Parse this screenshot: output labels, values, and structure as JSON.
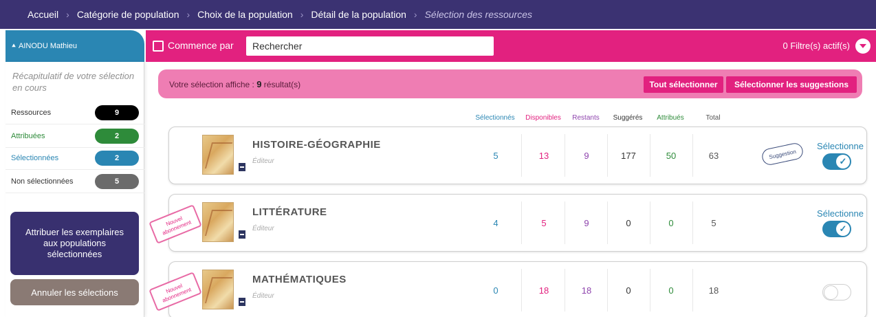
{
  "breadcrumb": {
    "items": [
      "Accueil",
      "Catégorie de population",
      "Choix de la population",
      "Détail de la population"
    ],
    "current": "Sélection des ressources"
  },
  "user": {
    "name": "AINODU Mathieu"
  },
  "sidebar": {
    "recap": "Récapitulatif de votre sélection en cours",
    "stats": [
      {
        "label": "Ressources",
        "value": "9",
        "color": "#000000",
        "label_color": "#333333"
      },
      {
        "label": "Attribuées",
        "value": "2",
        "color": "#2e8b3a",
        "label_color": "#2e8b3a"
      },
      {
        "label": "Sélectionnées",
        "value": "2",
        "color": "#2a86b3",
        "label_color": "#2a86b3"
      },
      {
        "label": "Non sélectionnées",
        "value": "5",
        "color": "#6b6b6b",
        "label_color": "#333333"
      }
    ],
    "assign_button": "Attribuer les exemplaires aux populations sélectionnées",
    "cancel_button": "Annuler les sélections"
  },
  "search": {
    "checkbox_label": "Commence par",
    "placeholder": "Rechercher",
    "filters": "0 Filtre(s) actif(s)"
  },
  "banner": {
    "text_before": "Votre sélection affiche :",
    "count": "9",
    "text_after": "résultat(s)",
    "select_all": "Tout sélectionner",
    "select_suggestions": "Sélectionner les suggestions"
  },
  "columns": [
    {
      "label": "Sélectionnés",
      "color": "#2a86b3"
    },
    {
      "label": "Disponibles",
      "color": "#e2217f"
    },
    {
      "label": "Restants",
      "color": "#8e44ad"
    },
    {
      "label": "Suggérés",
      "color": "#333333"
    },
    {
      "label": "Attribués",
      "color": "#2e8b3a"
    },
    {
      "label": "Total",
      "color": "#555555"
    }
  ],
  "rows": [
    {
      "title": "HISTOIRE-GÉOGRAPHIE",
      "editor": "Éditeur",
      "values": [
        "5",
        "13",
        "9",
        "177",
        "50",
        "63"
      ],
      "suggestion": "Suggestion",
      "new_subscription": "",
      "select_label": "Sélectionne",
      "selected": true
    },
    {
      "title": "LITTÉRATURE",
      "editor": "Éditeur",
      "values": [
        "4",
        "5",
        "9",
        "0",
        "0",
        "5"
      ],
      "suggestion": "",
      "new_subscription": "Nouvel abonnement",
      "select_label": "Sélectionne",
      "selected": true
    },
    {
      "title": "MATHÉMATIQUES",
      "editor": "Éditeur",
      "values": [
        "0",
        "18",
        "18",
        "0",
        "0",
        "18"
      ],
      "suggestion": "",
      "new_subscription": "Nouvel abonnement",
      "select_label": "",
      "selected": false
    }
  ]
}
